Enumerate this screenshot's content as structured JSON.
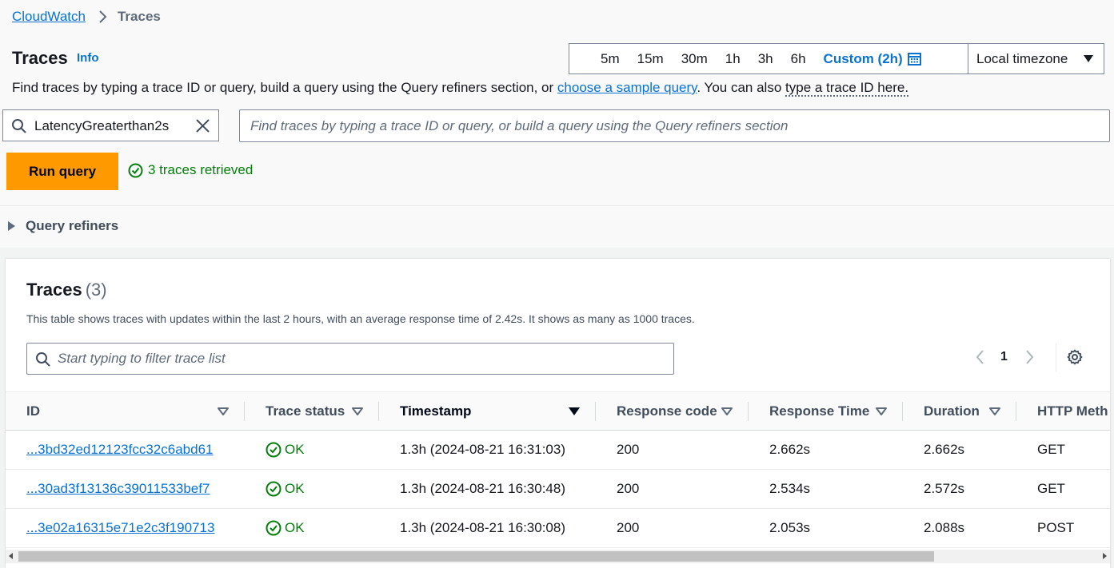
{
  "breadcrumb": {
    "root": "CloudWatch",
    "current": "Traces"
  },
  "header": {
    "title": "Traces",
    "info": "Info"
  },
  "time_range": {
    "options": [
      "5m",
      "15m",
      "30m",
      "1h",
      "3h",
      "6h"
    ],
    "custom": "Custom (2h)",
    "timezone": "Local timezone"
  },
  "description": {
    "part1": "Find traces by typing a trace ID or query, build a query using the Query refiners section, or ",
    "link1": "choose a sample query",
    "part2": ". You can also ",
    "link2": "type a trace ID here."
  },
  "query": {
    "token": "LatencyGreaterthan2s",
    "placeholder": "Find traces by typing a trace ID or query, or build a query using the Query refiners section",
    "run_label": "Run query",
    "status": "3 traces retrieved"
  },
  "refiners": {
    "label": "Query refiners"
  },
  "table": {
    "title": "Traces",
    "count": "(3)",
    "description": "This table shows traces with updates within the last 2 hours, with an average response time of 2.42s. It shows as many as 1000 traces.",
    "filter_placeholder": "Start typing to filter trace list",
    "page": "1",
    "columns": [
      "ID",
      "Trace status",
      "Timestamp",
      "Response code",
      "Response Time",
      "Duration",
      "HTTP Meth"
    ],
    "rows": [
      {
        "id": "...3bd32ed12123fcc32c6abd61",
        "status": "OK",
        "timestamp": "1.3h (2024-08-21 16:31:03)",
        "code": "200",
        "response_time": "2.662s",
        "duration": "2.662s",
        "method": "GET"
      },
      {
        "id": "...30ad3f13136c39011533bef7",
        "status": "OK",
        "timestamp": "1.3h (2024-08-21 16:30:48)",
        "code": "200",
        "response_time": "2.534s",
        "duration": "2.572s",
        "method": "GET"
      },
      {
        "id": "...3e02a16315e71e2c3f190713",
        "status": "OK",
        "timestamp": "1.3h (2024-08-21 16:30:08)",
        "code": "200",
        "response_time": "2.053s",
        "duration": "2.088s",
        "method": "POST"
      }
    ]
  },
  "colors": {
    "link": "#0972d3",
    "primary_button": "#ff9900",
    "success": "#037f0c"
  }
}
